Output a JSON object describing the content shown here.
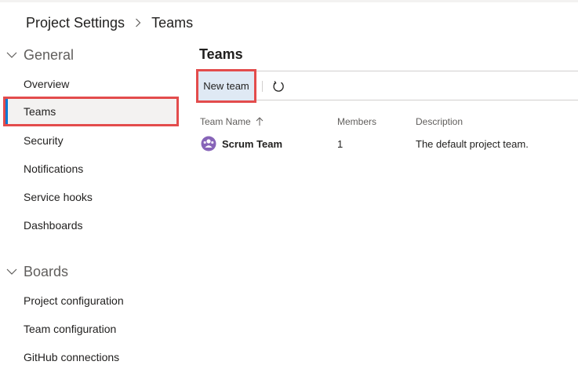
{
  "breadcrumb": {
    "root": "Project Settings",
    "current": "Teams"
  },
  "sidebar": {
    "groups": [
      {
        "label": "General",
        "items": [
          "Overview",
          "Teams",
          "Security",
          "Notifications",
          "Service hooks",
          "Dashboards"
        ]
      },
      {
        "label": "Boards",
        "items": [
          "Project configuration",
          "Team configuration",
          "GitHub connections"
        ]
      }
    ],
    "selected": "Teams"
  },
  "main": {
    "title": "Teams",
    "toolbar": {
      "new_team_label": "New team",
      "refresh_icon": "refresh-icon"
    },
    "table": {
      "columns": [
        "Team Name",
        "Members",
        "Description"
      ],
      "sort_icon": "sort-ascending-icon",
      "rows": [
        {
          "name": "Scrum Team",
          "members": "1",
          "description": "The default project team.",
          "avatar_icon": "team-avatar-icon"
        }
      ]
    }
  },
  "colors": {
    "accent": "#0078d4",
    "highlight_border": "#e34c4c",
    "selected_bg": "#f3f2f1",
    "button_bg": "#dfe9f4",
    "avatar": "#8764b8"
  }
}
